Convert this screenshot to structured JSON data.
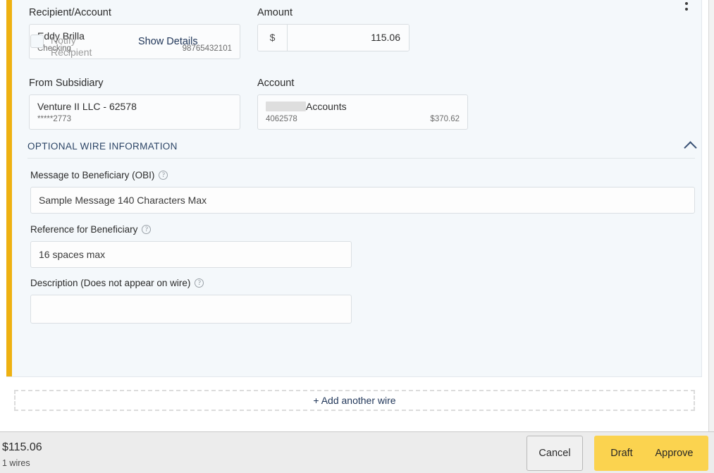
{
  "wire": {
    "recipient": {
      "label": "Recipient/Account",
      "name": "Eddy Brilla",
      "type": "Checking",
      "account_number": "98765432101"
    },
    "amount": {
      "label": "Amount",
      "currency_symbol": "$",
      "value": "115.06"
    },
    "notify": {
      "label_line1": "Notify",
      "label_line2": "Recipient",
      "checked": false
    },
    "show_details_label": "Show Details",
    "from_subsidiary": {
      "label": "From Subsidiary",
      "name": "Venture II LLC - 62578",
      "masked_account": "*****2773"
    },
    "account": {
      "label": "Account",
      "name_suffix": "Accounts",
      "number": "4062578",
      "balance": "$370.62"
    },
    "optional_section": {
      "title": "OPTIONAL WIRE INFORMATION",
      "collapse_icon": "chevron-up-icon",
      "fields": [
        {
          "label": "Message to Beneficiary (OBI)",
          "value": "Sample Message 140 Characters Max",
          "help_glyph": "?"
        },
        {
          "label": "Reference for Beneficiary",
          "value": "16 spaces max",
          "help_glyph": "?"
        },
        {
          "label": "Description (Does not appear on wire)",
          "value": "",
          "help_glyph": "?"
        }
      ]
    },
    "menu_icon": "kebab-menu-icon"
  },
  "add_another_wire_label": "+ Add another wire",
  "footer": {
    "total": "$115.06",
    "count": "1 wires",
    "cancel_label": "Cancel",
    "draft_label": "Draft",
    "approve_label": "Approve"
  },
  "colors": {
    "accent_bar": "#eeb111",
    "primary_button": "#fbd34f",
    "card_background": "#f4f8fb",
    "link": "#1f3558"
  }
}
